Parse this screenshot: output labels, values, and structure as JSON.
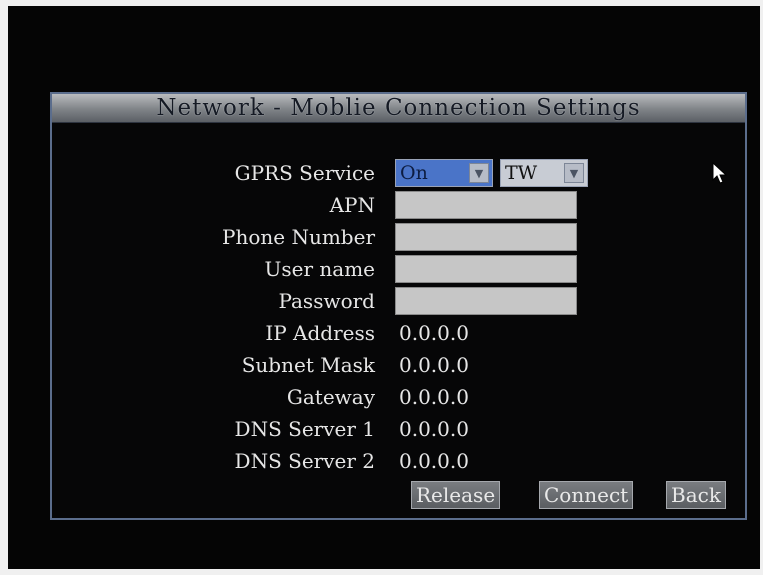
{
  "dialog": {
    "title": "Network - Moblie Connection Settings"
  },
  "fields": {
    "gprs_service": {
      "label": "GPRS Service",
      "value": "On",
      "region": "TW"
    },
    "apn": {
      "label": "APN",
      "value": ""
    },
    "phone_number": {
      "label": "Phone Number",
      "value": ""
    },
    "user_name": {
      "label": "User name",
      "value": ""
    },
    "password": {
      "label": "Password",
      "value": ""
    },
    "ip_address": {
      "label": "IP Address",
      "value": "0.0.0.0"
    },
    "subnet_mask": {
      "label": "Subnet Mask",
      "value": "0.0.0.0"
    },
    "gateway": {
      "label": "Gateway",
      "value": "0.0.0.0"
    },
    "dns_server_1": {
      "label": "DNS Server 1",
      "value": "0.0.0.0"
    },
    "dns_server_2": {
      "label": "DNS Server 2",
      "value": "0.0.0.0"
    }
  },
  "buttons": {
    "release": "Release",
    "connect": "Connect",
    "back": "Back"
  },
  "icons": {
    "dropdown": "chevron-down-icon",
    "pointer": "mouse-pointer-icon"
  },
  "colors": {
    "screen_bg": "#050505",
    "dialog_border": "#5b6d8c",
    "selected_dropdown": "#4a74c8",
    "input_bg": "#c6c6c6",
    "text": "#e6e6e6"
  }
}
